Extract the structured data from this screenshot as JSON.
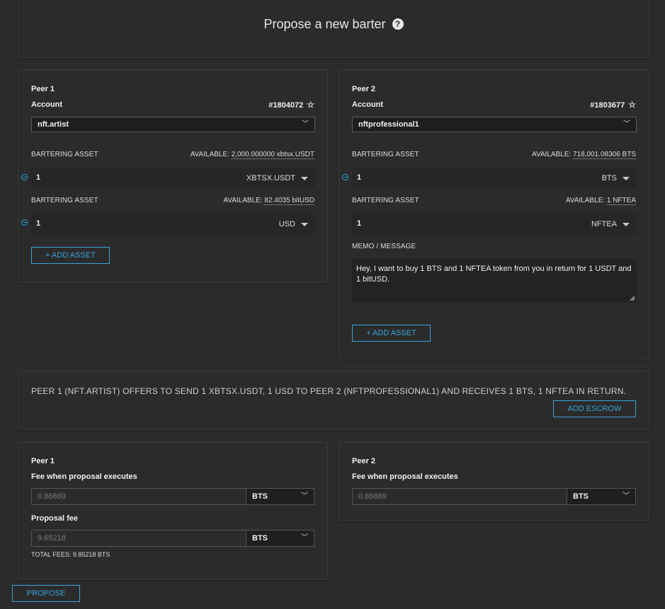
{
  "header": {
    "title": "Propose a new barter",
    "help_icon": "?"
  },
  "peer1": {
    "title": "Peer 1",
    "account_label": "Account",
    "account_number": "#1804072",
    "account_name": "nft.artist",
    "assets": [
      {
        "label": "BARTERING ASSET",
        "available_prefix": "AVAILABLE:",
        "available_value": "2,000.000000 xbtsx.USDT",
        "amount": "1",
        "symbol": "XBTSX.USDT"
      },
      {
        "label": "BARTERING ASSET",
        "available_prefix": "AVAILABLE:",
        "available_value": "82.4035 bitUSD",
        "amount": "1",
        "symbol": "USD"
      }
    ],
    "add_asset_label": "+ ADD ASSET"
  },
  "peer2": {
    "title": "Peer 2",
    "account_label": "Account",
    "account_number": "#1803677",
    "account_name": "nftprofessional1",
    "assets": [
      {
        "label": "BARTERING ASSET",
        "available_prefix": "AVAILABLE:",
        "available_value": "718,001.08306 BTS",
        "amount": "1",
        "symbol": "BTS"
      },
      {
        "label": "BARTERING ASSET",
        "available_prefix": "AVAILABLE:",
        "available_value": "1 NFTEA",
        "amount": "1",
        "symbol": "NFTEA"
      }
    ],
    "memo_label": "MEMO / MESSAGE",
    "memo_text": "Hey, I want to buy 1 BTS and 1 NFTEA token from you in return for 1 USDT and 1 bitUSD.",
    "add_asset_label": "+ ADD ASSET"
  },
  "summary": {
    "text": "PEER 1 (NFT.ARTIST) OFFERS TO SEND 1 XBTSX.USDT, 1 USD TO PEER 2 (NFTPROFESSIONAL1) AND RECEIVES 1 BTS, 1 NFTEA IN RETURN.",
    "add_escrow_label": "ADD ESCROW"
  },
  "fees1": {
    "title": "Peer 1",
    "exec_label": "Fee when proposal executes",
    "exec_value": "0.86869",
    "exec_asset": "BTS",
    "proposal_label": "Proposal fee",
    "proposal_value": "9.65218",
    "proposal_asset": "BTS",
    "total": "TOTAL FEES: 9.85218 BTS"
  },
  "fees2": {
    "title": "Peer 2",
    "exec_label": "Fee when proposal executes",
    "exec_value": "0.86869",
    "exec_asset": "BTS"
  },
  "propose_label": "PROPOSE",
  "colors": {
    "accent": "#3aa3d9",
    "background": "#2b2b2b"
  }
}
